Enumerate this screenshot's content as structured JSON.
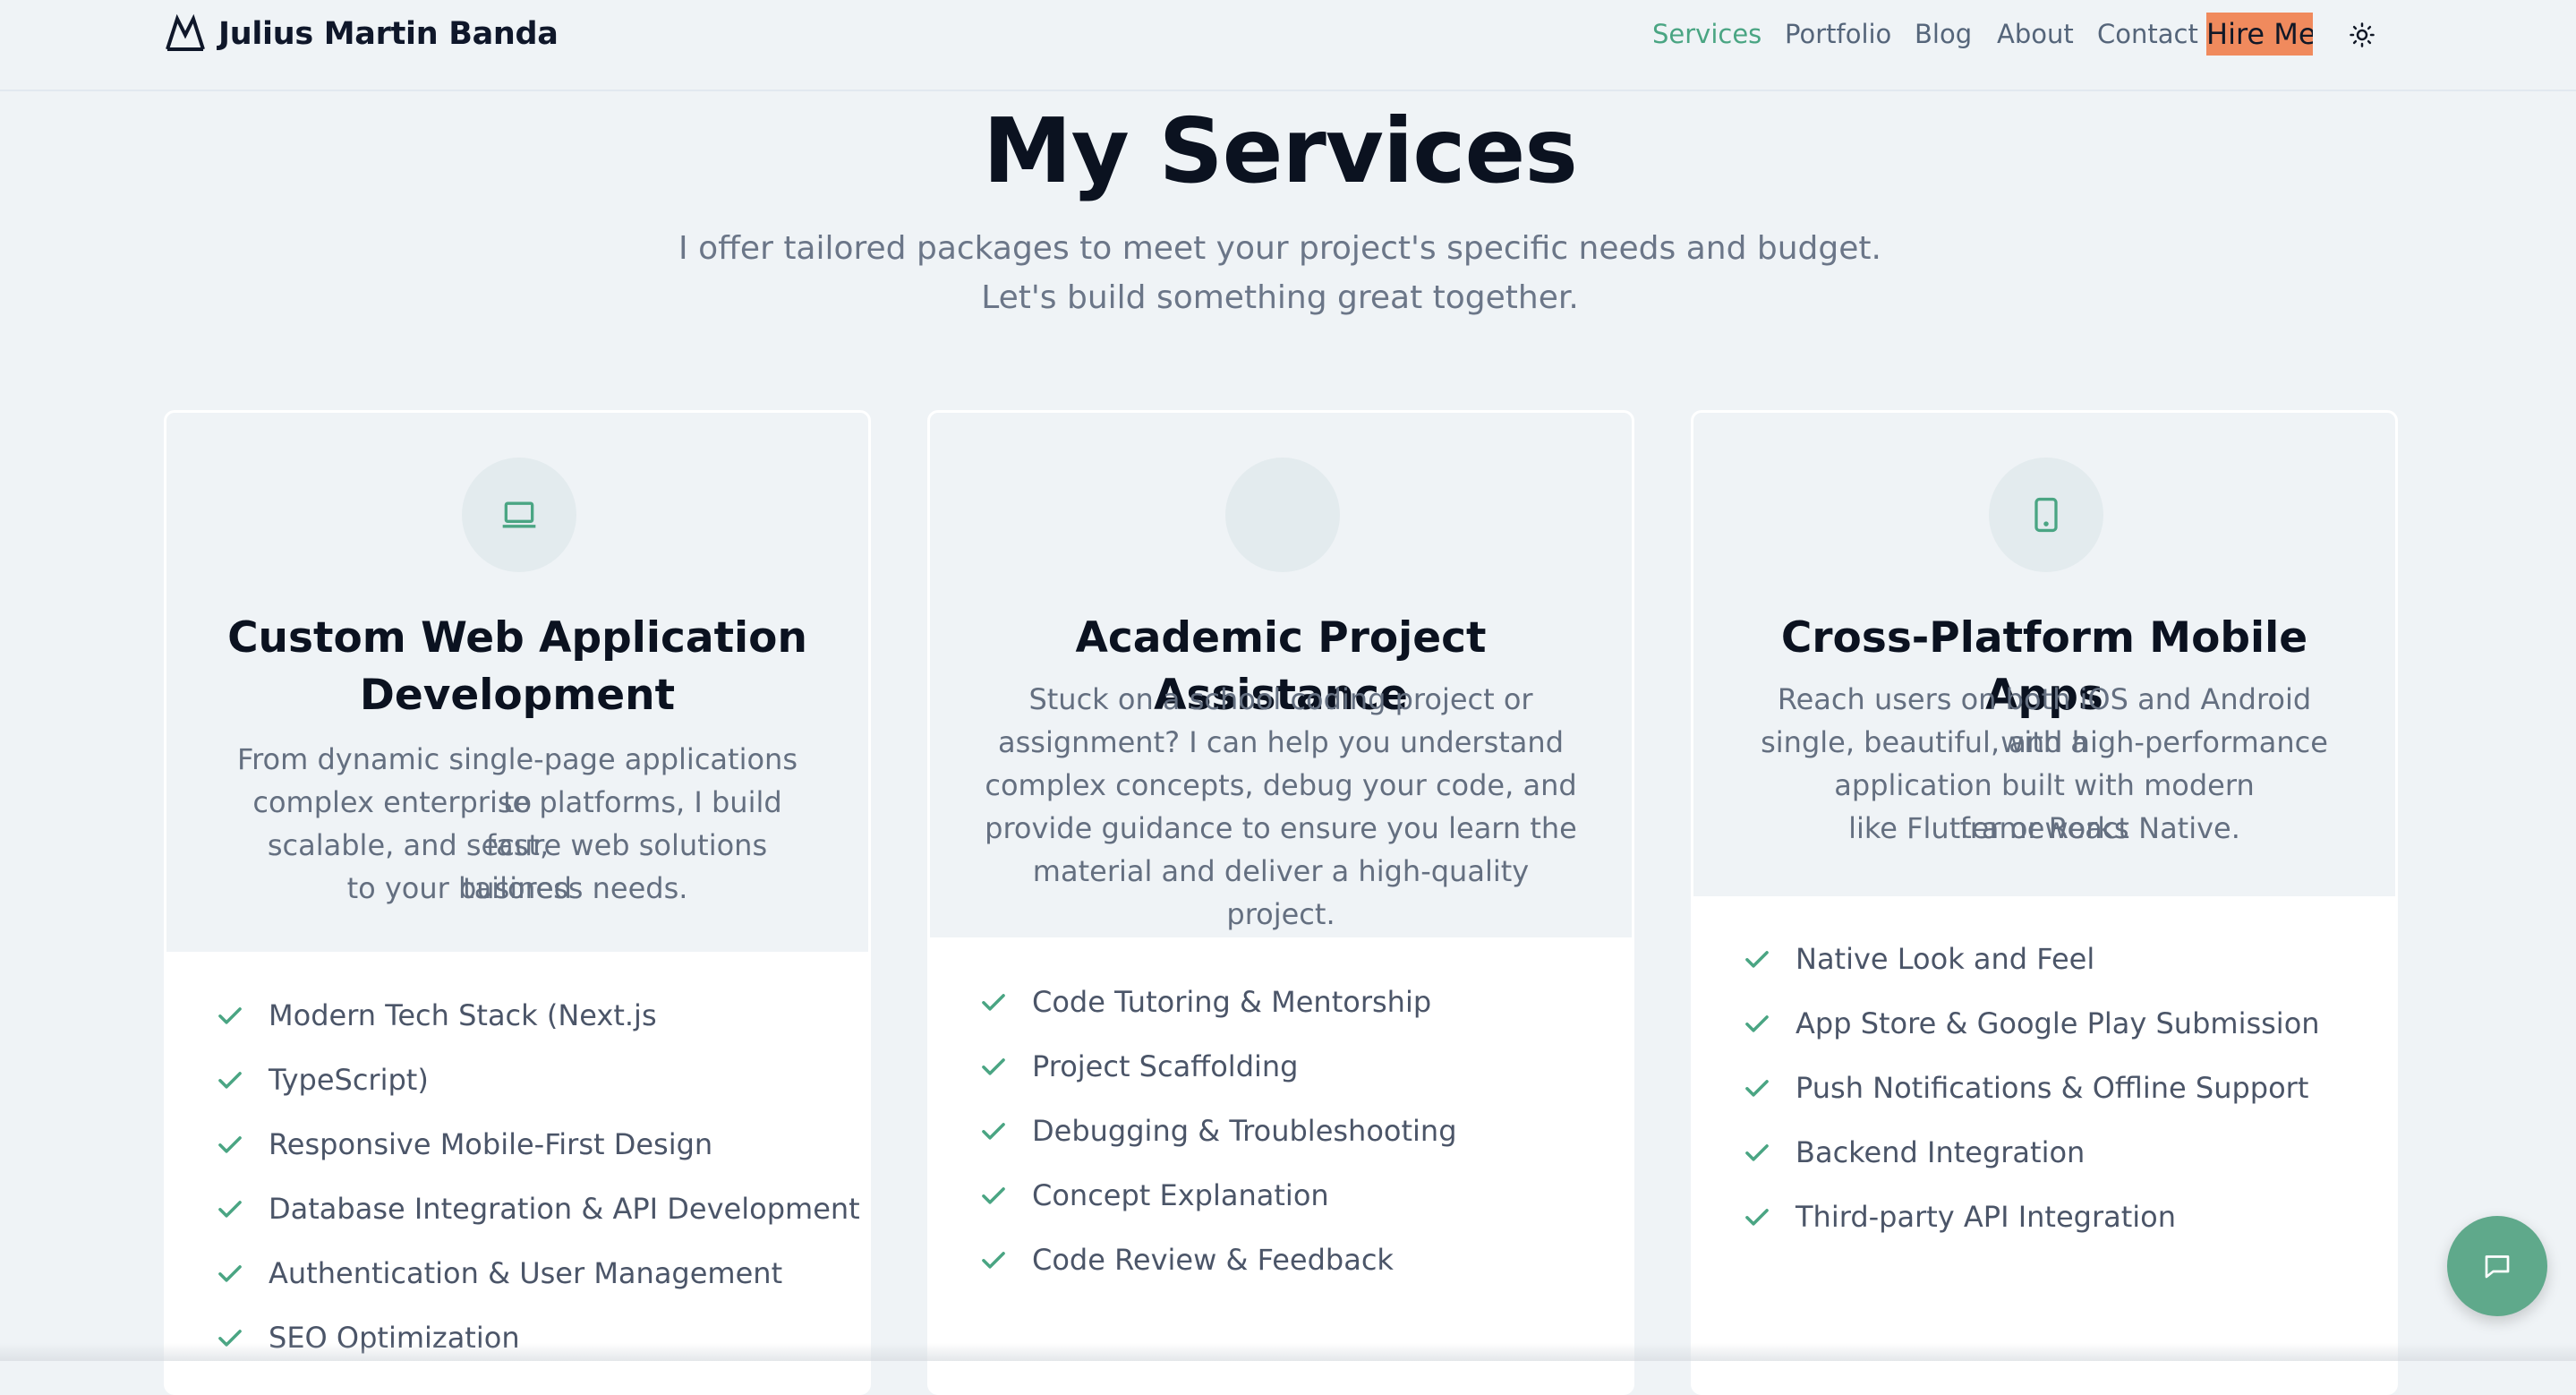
{
  "header": {
    "brand_name": "Julius Martin Banda",
    "brand_icon": "mountain-logo-icon",
    "nav": [
      "Services",
      "Portfolio",
      "Blog",
      "About",
      "Contact"
    ],
    "active_nav": "Services",
    "hire_label": "Hire Me",
    "theme_icon": "sun-icon"
  },
  "hero": {
    "title": "My Services",
    "subtitle_line1": "I offer tailored packages to meet your project's specific needs and budget.",
    "subtitle_line2": "Let's build something great together."
  },
  "services": [
    {
      "icon": "laptop-icon",
      "title_line1": "Custom Web Application",
      "title_line2": "Development",
      "description": [
        "From dynamic single-page applications to",
        "complex enterprise platforms, I build fast,",
        "scalable, and secure web solutions tailored",
        "to your business needs."
      ],
      "features": [
        "Modern Tech Stack (Next.js",
        "TypeScript)",
        "Responsive Mobile-First Design",
        "Database Integration & API Development",
        "Authentication & User Management",
        "SEO Optimization"
      ]
    },
    {
      "icon": "graduation-cap-icon",
      "title_line1": "Academic Project Assistance",
      "description": [
        "Stuck on a school coding project or",
        "assignment? I can help you understand",
        "complex concepts, debug your code, and",
        "provide guidance to ensure you learn the",
        "material and deliver a high-quality project."
      ],
      "features": [
        "Code Tutoring & Mentorship",
        "Project Scaffolding",
        "Debugging & Troubleshooting",
        "Concept Explanation",
        "Code Review & Feedback"
      ]
    },
    {
      "icon": "smartphone-icon",
      "title_line1": "Cross-Platform Mobile Apps",
      "description": [
        "Reach users on both iOS and Android with a",
        "single, beautiful, and high-performance",
        "application built with modern frameworks",
        "like Flutter or React Native."
      ],
      "features": [
        "Native Look and Feel",
        "App Store & Google Play Submission",
        "Push Notifications & Offline Support",
        "Backend Integration",
        "Third-party API Integration"
      ]
    }
  ],
  "chat_icon": "chat-bubble-icon",
  "colors": {
    "accent": "#4aa583",
    "hire_button": "#f08a5d",
    "background": "#eff3f6"
  }
}
